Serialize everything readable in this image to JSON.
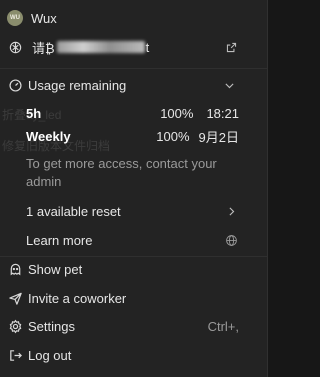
{
  "background_hints": {
    "text_1": "折叠ay_led",
    "text_2": "修复旧版本文件归档"
  },
  "user": {
    "avatar_initials": "WU",
    "name": "Wux"
  },
  "account": {
    "visible_prefix": "请₿",
    "visible_suffix": "t"
  },
  "usage": {
    "header": "Usage remaining",
    "rows": [
      {
        "label": "5h",
        "percent": "100%",
        "reset": "18:21"
      },
      {
        "label": "Weekly",
        "percent": "100%",
        "reset": "9月2日"
      }
    ],
    "note": "To get more access, contact your admin",
    "reset_label": "1 available reset",
    "learn_more": "Learn more"
  },
  "menu": {
    "show_pet": "Show pet",
    "invite": "Invite a coworker",
    "settings": "Settings",
    "settings_shortcut": "Ctrl+,",
    "logout": "Log out"
  },
  "colors": {
    "panel": "#232323",
    "text": "#e6e6e6",
    "muted": "#9a9a9a"
  }
}
